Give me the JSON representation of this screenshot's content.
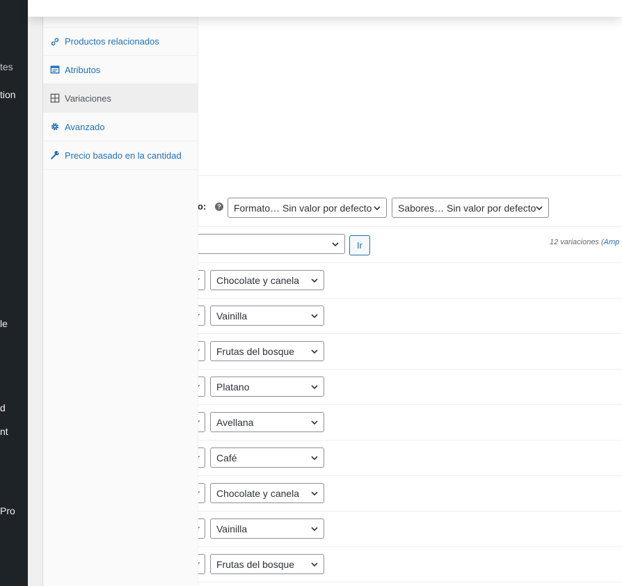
{
  "admin_menu": {
    "fragments": [
      "tes",
      "tion",
      "le",
      "d",
      "nt",
      "Pro"
    ]
  },
  "tabs": [
    {
      "label": "Productos relacionados",
      "icon": "link-icon",
      "active": false
    },
    {
      "label": "Atributos",
      "icon": "table-icon",
      "active": false
    },
    {
      "label": "Variaciones",
      "icon": "grid-icon",
      "active": true
    },
    {
      "label": "Avanzado",
      "icon": "gear-icon",
      "active": false
    },
    {
      "label": "Precio basado en la cantidad",
      "icon": "wrench-icon",
      "active": false
    }
  ],
  "defaults": {
    "label": "o:",
    "help": "?",
    "formato_select": "Formato… Sin valor por defecto",
    "sabores_select": "Sabores… Sin valor por defecto"
  },
  "bulk": {
    "action_select": "",
    "go_label": "Ir",
    "count_text": "12 variaciones (",
    "count_link": "Amp"
  },
  "variations": [
    {
      "flavor": "Chocolate y canela"
    },
    {
      "flavor": "Vainilla"
    },
    {
      "flavor": "Frutas del bosque"
    },
    {
      "flavor": "Platano"
    },
    {
      "flavor": "Avellana"
    },
    {
      "flavor": "Café"
    },
    {
      "flavor": "Chocolate y canela"
    },
    {
      "flavor": "Vainilla"
    },
    {
      "flavor": "Frutas del bosque"
    }
  ],
  "colors": {
    "link": "#2271b1",
    "sidebar_bg": "#1d2327",
    "active_tab_bg": "#eeeeee"
  }
}
